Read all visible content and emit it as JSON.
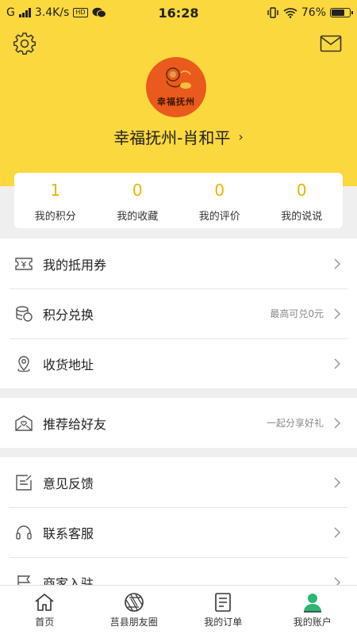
{
  "status_bar": {
    "carrier": "G",
    "network_speed": "3.4K/s",
    "time": "16:28",
    "battery_percent": "76%",
    "battery_level": 0.76
  },
  "profile": {
    "avatar_caption": "幸福抚州",
    "username": "幸福抚州-肖和平",
    "chevron": "›"
  },
  "stats": [
    {
      "value": "1",
      "label": "我的积分"
    },
    {
      "value": "0",
      "label": "我的收藏"
    },
    {
      "value": "0",
      "label": "我的评价"
    },
    {
      "value": "0",
      "label": "我的说说"
    }
  ],
  "menu_groups": [
    [
      {
        "icon": "coupon-icon",
        "label": "我的抵用券",
        "hint": ""
      },
      {
        "icon": "coins-icon",
        "label": "积分兑换",
        "hint": "最高可兑0元"
      },
      {
        "icon": "location-pin-icon",
        "label": "收货地址",
        "hint": ""
      }
    ],
    [
      {
        "icon": "heart-envelope-icon",
        "label": "推荐给好友",
        "hint": "一起分享好礼"
      }
    ],
    [
      {
        "icon": "feedback-icon",
        "label": "意见反馈",
        "hint": ""
      },
      {
        "icon": "headset-icon",
        "label": "联系客服",
        "hint": ""
      },
      {
        "icon": "flag-icon",
        "label": "商家入驻",
        "hint": ""
      }
    ]
  ],
  "tabs": [
    {
      "icon": "home-icon",
      "label": "首页"
    },
    {
      "icon": "aperture-icon",
      "label": "莒县朋友圈"
    },
    {
      "icon": "order-icon",
      "label": "我的订单"
    },
    {
      "icon": "user-icon",
      "label": "我的账户"
    }
  ],
  "colors": {
    "brand_yellow": "#fcd83f",
    "stat_number": "#e8b500",
    "active_tab": "#2bb673"
  }
}
